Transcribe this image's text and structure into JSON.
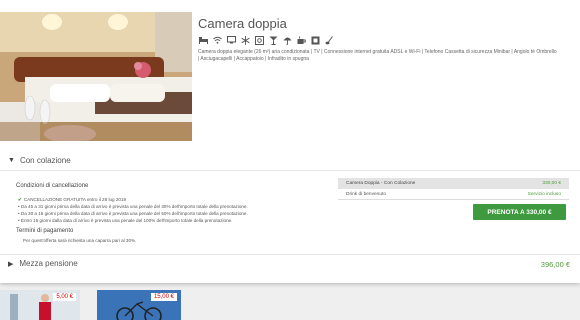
{
  "room": {
    "title": "Camera doppia",
    "description": "Camera doppia elegante (26 m²) aria condizionata | TV | Connessione internet gratuita ADSL e Wi-Fi | Telefono Cassetta di sicurezza Minibar | Angolo tè Ombrello | Asciugacapelli | Accappatoio | Infradito in spugna",
    "amenity_icons": [
      "bed-icon",
      "wifi-icon",
      "tv-icon",
      "snowflake-icon",
      "safe-icon",
      "cocktail-icon",
      "umbrella-icon",
      "tea-icon",
      "hairdryer-icon",
      "slippers-icon"
    ]
  },
  "tariff_open": {
    "label": "Con colazione",
    "cancellation_title": "Condizioni di cancellazione",
    "cancellation_lines": [
      "CANCELLAZIONE GRATUITA entro il 28 lug 2019",
      "Da 45 a 31 giorni prima della data di arrivo è prevista una penale del 30% dell'importo totale della prenotazione.",
      "Da 30 a 16 giorni prima della data di arrivo è prevista una penale del 50% dell'importo totale della prenotazione.",
      "Entro 15 giorni dalla data di arrivo è prevista una penale del 100% dell'importo totale della prenotazione."
    ],
    "payment_title": "Termini di pagamento",
    "payment_note": "Per quest'offerta sarà richiesta una caparra pari al 30%."
  },
  "summary": {
    "row_label": "Camera Doppia - Con Colazione",
    "row_price": "330,00 €",
    "extra_label": "Drink di benvenuto",
    "extra_value": "Servizio incluso",
    "book_button": "PRENOTA A 330,00 €"
  },
  "tariff_closed": {
    "label": "Mezza pensione",
    "price": "396,00 €"
  },
  "thumbnails": [
    {
      "price": "5,00 €"
    },
    {
      "price": "15,00 €"
    }
  ],
  "colors": {
    "accent_green": "#3f9a3f",
    "price_green": "#4e9a3a",
    "price_red": "#cc0000"
  }
}
